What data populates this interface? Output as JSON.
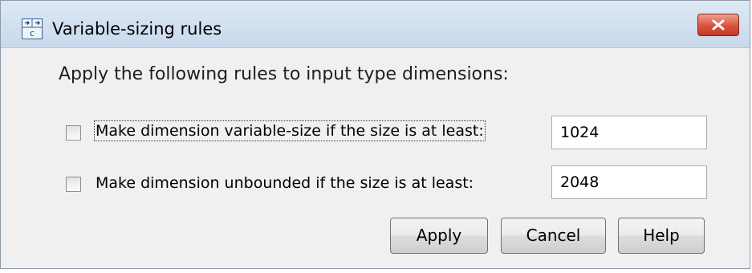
{
  "window": {
    "title": "Variable-sizing rules",
    "icon": "variable-sizing-app-icon",
    "close_icon": "close-icon"
  },
  "dialog": {
    "heading": "Apply the following rules to input type dimensions:",
    "rules": [
      {
        "label": "Make dimension variable-size if the size is at least:",
        "checked": false,
        "value": "1024"
      },
      {
        "label": "Make dimension unbounded if the size is at least:",
        "checked": false,
        "value": "2048"
      }
    ]
  },
  "buttons": {
    "apply": "Apply",
    "cancel": "Cancel",
    "help": "Help"
  },
  "colors": {
    "titlebar": "#c9d9ec",
    "close_button": "#d9533e",
    "background": "#f0f0f0"
  }
}
